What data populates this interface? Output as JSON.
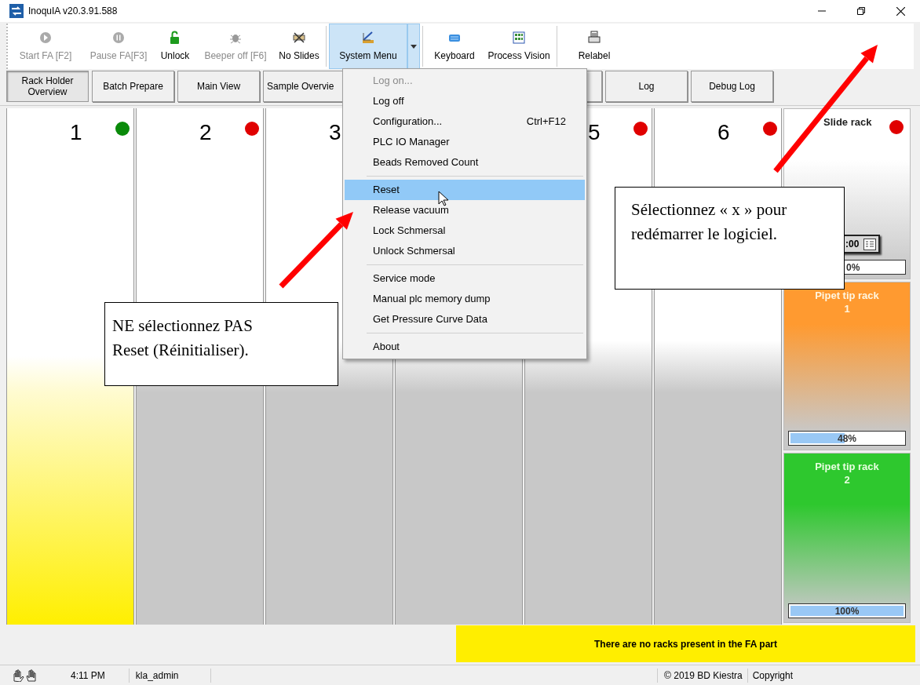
{
  "window": {
    "title": "InoquIA v20.3.91.588"
  },
  "toolbar": [
    {
      "label": "Start FA [F2]",
      "kind": "play",
      "disabled": true
    },
    {
      "label": "Pause FA[F3]",
      "kind": "pause",
      "disabled": true
    },
    {
      "label": "Unlock",
      "kind": "lock",
      "disabled": false
    },
    {
      "label": "Beeper off [F6]",
      "kind": "bug",
      "disabled": true
    },
    {
      "label": "No Slides",
      "kind": "slides",
      "disabled": false
    },
    {
      "label": "System Menu",
      "kind": "menu",
      "disabled": false,
      "selected": true
    },
    {
      "label": "Keyboard",
      "kind": "keyboard",
      "disabled": false
    },
    {
      "label": "Process Vision",
      "kind": "grid",
      "disabled": false
    },
    {
      "label": "Relabel",
      "kind": "printer",
      "disabled": false
    }
  ],
  "tabs": [
    {
      "label": "Rack Holder Overview",
      "selected": true
    },
    {
      "label": "Batch Prepare",
      "selected": false
    },
    {
      "label": "Main View",
      "selected": false
    },
    {
      "label": "Sample Overvie",
      "selected": false
    },
    {
      "label": "Log",
      "selected": false
    },
    {
      "label": "Debug Log",
      "selected": false
    }
  ],
  "racks": [
    {
      "number": "1",
      "color": "#0a8a0a",
      "kind": "filled"
    },
    {
      "number": "2",
      "color": "#e00000",
      "kind": "empty"
    },
    {
      "number": "3",
      "kind": "empty"
    },
    {
      "kind": "empty"
    },
    {
      "number": "5",
      "color": "#e00000",
      "kind": "empty"
    },
    {
      "number": "6",
      "color": "#e00000",
      "kind": "empty"
    }
  ],
  "side_racks": [
    {
      "title": "Slide rack",
      "color": "#e00000",
      "timer": ":00",
      "level": 0,
      "reading": "0%",
      "kind": "neutral"
    },
    {
      "title": "Pipet tip rack\n1",
      "level": 0.48,
      "reading": "48%",
      "kind": "orange"
    },
    {
      "title": "Pipet tip rack\n2",
      "level": 1,
      "reading": "100%",
      "kind": "green"
    }
  ],
  "system_menu": {
    "items": [
      {
        "label": "Log on...",
        "disabled": true,
        "selected": false
      },
      {
        "label": "Log off",
        "disabled": false,
        "selected": false
      },
      {
        "label": "Configuration...",
        "shortcut": "Ctrl+F12",
        "disabled": false,
        "selected": false
      },
      {
        "label": "PLC IO Manager",
        "disabled": false,
        "selected": false
      },
      {
        "label": "Beads Removed Count",
        "disabled": false,
        "selected": false,
        "separator_after": true
      },
      {
        "label": "Reset",
        "disabled": false,
        "selected": true
      },
      {
        "label": "Release vacuum",
        "disabled": false,
        "selected": false
      },
      {
        "label": "Lock Schmersal",
        "disabled": false,
        "selected": false
      },
      {
        "label": "Unlock Schmersal",
        "disabled": false,
        "selected": false,
        "separator_after": true
      },
      {
        "label": "Service mode",
        "disabled": false,
        "selected": false
      },
      {
        "label": "Manual plc memory dump",
        "disabled": false,
        "selected": false
      },
      {
        "label": "Get Pressure Curve Data",
        "disabled": false,
        "selected": false,
        "separator_after": true
      },
      {
        "label": "About",
        "disabled": false,
        "selected": false
      }
    ]
  },
  "message": "There are no racks present in the FA part",
  "status_bar": {
    "time": "4:11 PM",
    "user": "kla_admin",
    "copyright": "© 2019 BD Kiestra",
    "copyright_label": "Copyright"
  },
  "annotations": [
    {
      "text": "NE sélectionnez PAS Reset (Réinitialiser)."
    },
    {
      "text": "Sélectionnez « x » pour redémarrer le logiciel."
    }
  ]
}
